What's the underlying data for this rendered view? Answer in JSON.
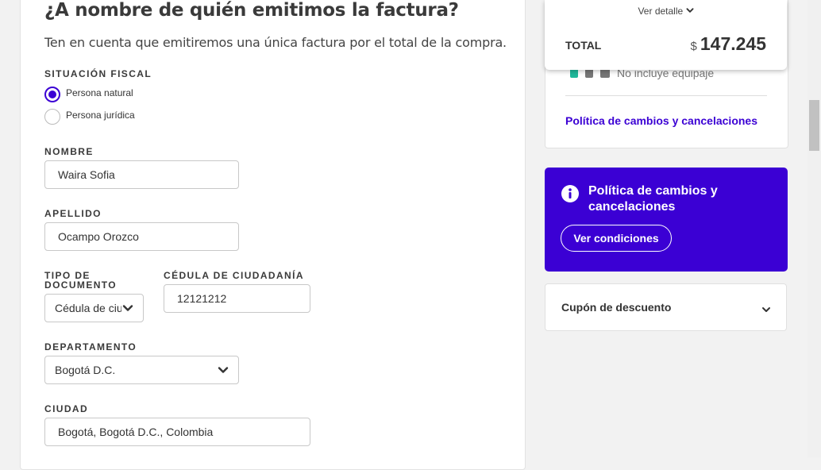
{
  "form": {
    "title": "¿A nombre de quién emitimos la factura?",
    "subtitle": "Ten en cuenta que emitiremos una única factura por el total de la compra.",
    "fiscal_label": "SITUACIÓN FISCAL",
    "fiscal_options": [
      {
        "label": "Persona natural",
        "selected": true
      },
      {
        "label": "Persona jurídica",
        "selected": false
      }
    ],
    "nombre_label": "NOMBRE",
    "nombre_value": "Waira Sofia",
    "apellido_label": "APELLIDO",
    "apellido_value": "Ocampo Orozco",
    "tipo_doc_label": "TIPO DE DOCUMENTO",
    "tipo_doc_value": "Cédula de ciudadanía",
    "cedula_label": "CÉDULA DE CIUDADANÍA",
    "cedula_value": "12121212",
    "departamento_label": "DEPARTAMENTO",
    "departamento_value": "Bogotá D.C.",
    "ciudad_label": "CIUDAD",
    "ciudad_value": "Bogotá, Bogotá D.C., Colombia"
  },
  "summary": {
    "detail_link": "Ver detalle",
    "total_label": "TOTAL",
    "currency": "$",
    "total_amount": "147.245",
    "equipment_text": "No incluye equipaje",
    "policy_link": "Política de cambios y cancelaciones"
  },
  "policy_card": {
    "title": "Política de cambios y cancelaciones",
    "button": "Ver condiciones"
  },
  "coupon": {
    "label": "Cupón de descuento"
  },
  "colors": {
    "accent": "#3b00d4",
    "bag_icon": "#1fb89a",
    "icon_gray": "#777777"
  },
  "icons": [
    "chevron-down-icon",
    "info-icon",
    "carry-on-bag-icon",
    "checked-bag-icon"
  ]
}
